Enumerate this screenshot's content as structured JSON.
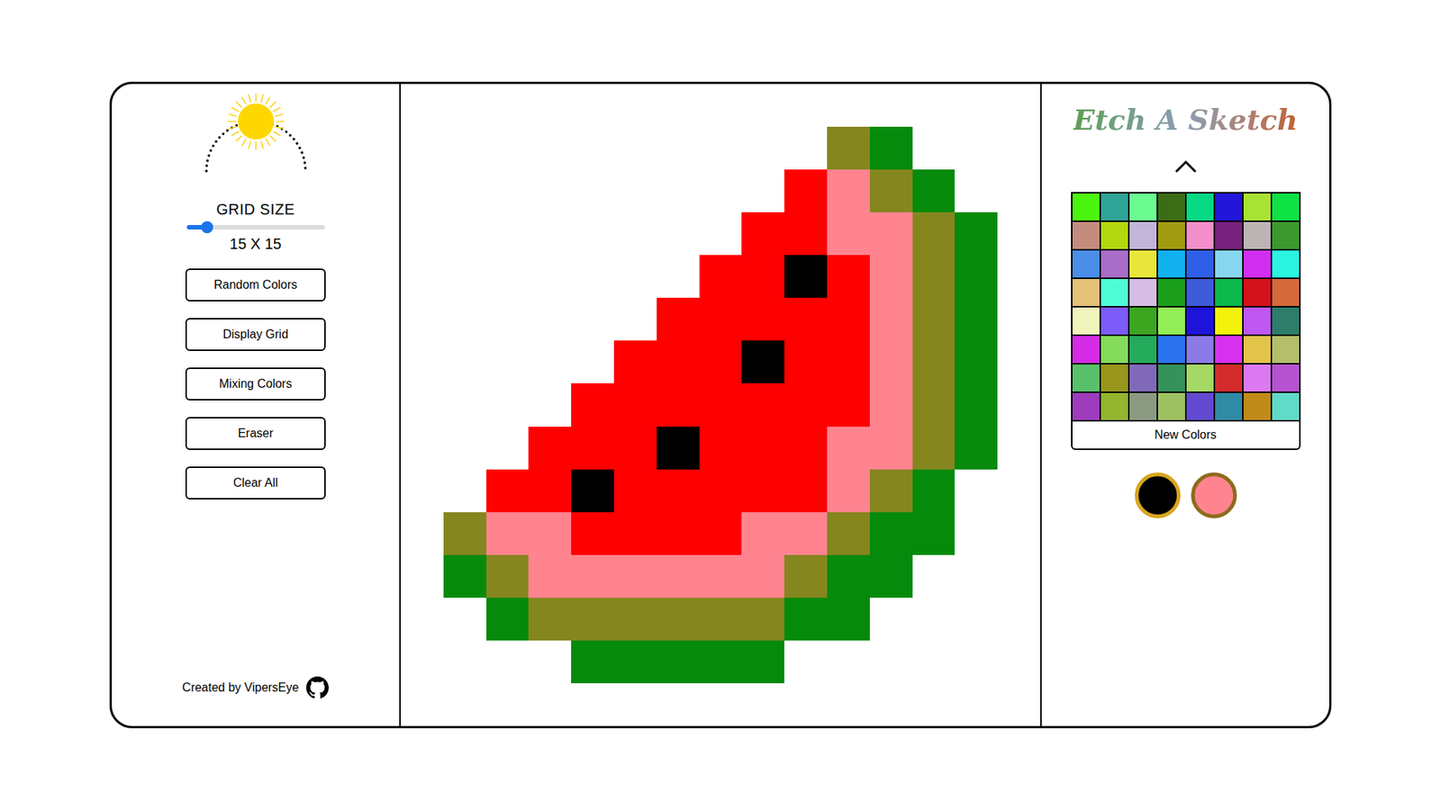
{
  "theme_toggle": {
    "dark": false
  },
  "grid_size": {
    "label": "GRID SIZE",
    "level": 0.15,
    "reading": "15 X 15"
  },
  "buttons": [
    "Random Colors",
    "Display Grid",
    "Mixing Colors",
    "Eraser",
    "Clear All"
  ],
  "footer": {
    "text": "Created by VipersEye"
  },
  "canvas": {
    "rows": [
      [
        null,
        null,
        null,
        null,
        null,
        null,
        null,
        null,
        null,
        null,
        null,
        null,
        null,
        null,
        null
      ],
      [
        null,
        null,
        null,
        null,
        null,
        null,
        null,
        null,
        null,
        null,
        "#85861e",
        "#058a0c",
        null,
        null,
        null
      ],
      [
        null,
        null,
        null,
        null,
        null,
        null,
        null,
        null,
        null,
        "#ff0000",
        "#ff8490",
        "#85861e",
        "#058a0c",
        null,
        null
      ],
      [
        null,
        null,
        null,
        null,
        null,
        null,
        null,
        null,
        "#ff0000",
        "#ff0000",
        "#ff8490",
        "#ff8490",
        "#85861e",
        "#058a0c",
        null
      ],
      [
        null,
        null,
        null,
        null,
        null,
        null,
        null,
        "#ff0000",
        "#ff0000",
        "#000000",
        "#ff0000",
        "#ff8490",
        "#85861e",
        "#058a0c",
        null
      ],
      [
        null,
        null,
        null,
        null,
        null,
        null,
        "#ff0000",
        "#ff0000",
        "#ff0000",
        "#ff0000",
        "#ff0000",
        "#ff8490",
        "#85861e",
        "#058a0c",
        null
      ],
      [
        null,
        null,
        null,
        null,
        null,
        "#ff0000",
        "#ff0000",
        "#ff0000",
        "#000000",
        "#ff0000",
        "#ff0000",
        "#ff8490",
        "#85861e",
        "#058a0c",
        null
      ],
      [
        null,
        null,
        null,
        null,
        "#ff0000",
        "#ff0000",
        "#ff0000",
        "#ff0000",
        "#ff0000",
        "#ff0000",
        "#ff0000",
        "#ff8490",
        "#85861e",
        "#058a0c",
        null
      ],
      [
        null,
        null,
        null,
        "#ff0000",
        "#ff0000",
        "#ff0000",
        "#000000",
        "#ff0000",
        "#ff0000",
        "#ff0000",
        "#ff8490",
        "#ff8490",
        "#85861e",
        "#058a0c",
        null
      ],
      [
        null,
        null,
        "#ff0000",
        "#ff0000",
        "#000000",
        "#ff0000",
        "#ff0000",
        "#ff0000",
        "#ff0000",
        "#ff0000",
        "#ff8490",
        "#85861e",
        "#058a0c",
        null,
        null
      ],
      [
        null,
        "#85861e",
        "#ff8490",
        "#ff8490",
        "#ff0000",
        "#ff0000",
        "#ff0000",
        "#ff0000",
        "#ff8490",
        "#ff8490",
        "#85861e",
        "#058a0c",
        "#058a0c",
        null,
        null
      ],
      [
        null,
        "#058a0c",
        "#85861e",
        "#ff8490",
        "#ff8490",
        "#ff8490",
        "#ff8490",
        "#ff8490",
        "#ff8490",
        "#85861e",
        "#058a0c",
        "#058a0c",
        null,
        null,
        null
      ],
      [
        null,
        null,
        "#058a0c",
        "#85861e",
        "#85861e",
        "#85861e",
        "#85861e",
        "#85861e",
        "#85861e",
        "#058a0c",
        "#058a0c",
        null,
        null,
        null,
        null
      ],
      [
        null,
        null,
        null,
        null,
        "#058a0c",
        "#058a0c",
        "#058a0c",
        "#058a0c",
        "#058a0c",
        null,
        null,
        null,
        null,
        null,
        null
      ],
      [
        null,
        null,
        null,
        null,
        null,
        null,
        null,
        null,
        null,
        null,
        null,
        null,
        null,
        null,
        null
      ]
    ]
  },
  "title": "Etch A Sketch",
  "palette": {
    "expanded": true,
    "colors": [
      "#4cf50f",
      "#2fa497",
      "#6bfb90",
      "#3d6c16",
      "#06d984",
      "#2116d9",
      "#a8e333",
      "#0ee245",
      "#c48c7f",
      "#b4d710",
      "#c2b5d8",
      "#a09c10",
      "#f48ec9",
      "#78217e",
      "#bdb5b5",
      "#3c992e",
      "#4a8ee8",
      "#a96ec8",
      "#e8e63a",
      "#11b1f0",
      "#2f5fe8",
      "#88d5f0",
      "#d12ef0",
      "#2bf5e0",
      "#e3c178",
      "#4ffbd5",
      "#d5bde3",
      "#1a9e1a",
      "#3e5ad8",
      "#0ab84b",
      "#d3121c",
      "#d4693b",
      "#f1f4bd",
      "#7d5bf8",
      "#3da520",
      "#93ee56",
      "#1e13d8",
      "#f2f20d",
      "#be58f1",
      "#2e7c6a",
      "#d52be6",
      "#85db5a",
      "#24ab5c",
      "#2a74f0",
      "#8a7be8",
      "#d830f0",
      "#e2c44a",
      "#b4bf6c",
      "#58c06a",
      "#98971b",
      "#8069b9",
      "#35925a",
      "#a5d865",
      "#d42c2c",
      "#db7af0",
      "#b653d0",
      "#9d3cbc",
      "#93b530",
      "#8c9a82",
      "#9ec061",
      "#6349d0",
      "#2f8aa3",
      "#c18b1a",
      "#61dac8"
    ],
    "button": "New Colors"
  },
  "current_colors": [
    {
      "color": "#000000",
      "selected": true
    },
    {
      "color": "#ff8490",
      "selected": false
    }
  ]
}
